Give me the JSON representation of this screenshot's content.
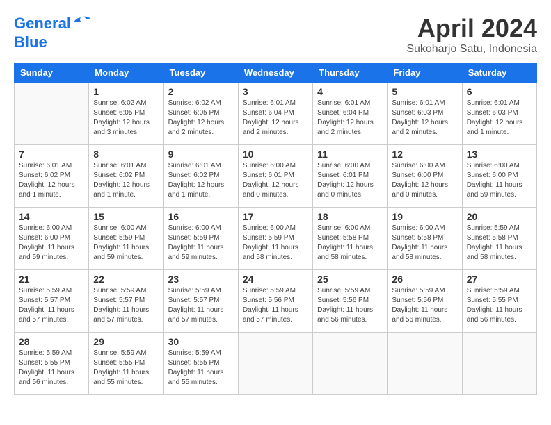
{
  "logo": {
    "line1": "General",
    "line2": "Blue"
  },
  "header": {
    "month_year": "April 2024",
    "location": "Sukoharjo Satu, Indonesia"
  },
  "days_of_week": [
    "Sunday",
    "Monday",
    "Tuesday",
    "Wednesday",
    "Thursday",
    "Friday",
    "Saturday"
  ],
  "weeks": [
    [
      {
        "day": "",
        "info": ""
      },
      {
        "day": "1",
        "info": "Sunrise: 6:02 AM\nSunset: 6:05 PM\nDaylight: 12 hours\nand 3 minutes."
      },
      {
        "day": "2",
        "info": "Sunrise: 6:02 AM\nSunset: 6:05 PM\nDaylight: 12 hours\nand 2 minutes."
      },
      {
        "day": "3",
        "info": "Sunrise: 6:01 AM\nSunset: 6:04 PM\nDaylight: 12 hours\nand 2 minutes."
      },
      {
        "day": "4",
        "info": "Sunrise: 6:01 AM\nSunset: 6:04 PM\nDaylight: 12 hours\nand 2 minutes."
      },
      {
        "day": "5",
        "info": "Sunrise: 6:01 AM\nSunset: 6:03 PM\nDaylight: 12 hours\nand 2 minutes."
      },
      {
        "day": "6",
        "info": "Sunrise: 6:01 AM\nSunset: 6:03 PM\nDaylight: 12 hours\nand 1 minute."
      }
    ],
    [
      {
        "day": "7",
        "info": "Sunrise: 6:01 AM\nSunset: 6:02 PM\nDaylight: 12 hours\nand 1 minute."
      },
      {
        "day": "8",
        "info": "Sunrise: 6:01 AM\nSunset: 6:02 PM\nDaylight: 12 hours\nand 1 minute."
      },
      {
        "day": "9",
        "info": "Sunrise: 6:01 AM\nSunset: 6:02 PM\nDaylight: 12 hours\nand 1 minute."
      },
      {
        "day": "10",
        "info": "Sunrise: 6:00 AM\nSunset: 6:01 PM\nDaylight: 12 hours\nand 0 minutes."
      },
      {
        "day": "11",
        "info": "Sunrise: 6:00 AM\nSunset: 6:01 PM\nDaylight: 12 hours\nand 0 minutes."
      },
      {
        "day": "12",
        "info": "Sunrise: 6:00 AM\nSunset: 6:00 PM\nDaylight: 12 hours\nand 0 minutes."
      },
      {
        "day": "13",
        "info": "Sunrise: 6:00 AM\nSunset: 6:00 PM\nDaylight: 11 hours\nand 59 minutes."
      }
    ],
    [
      {
        "day": "14",
        "info": "Sunrise: 6:00 AM\nSunset: 6:00 PM\nDaylight: 11 hours\nand 59 minutes."
      },
      {
        "day": "15",
        "info": "Sunrise: 6:00 AM\nSunset: 5:59 PM\nDaylight: 11 hours\nand 59 minutes."
      },
      {
        "day": "16",
        "info": "Sunrise: 6:00 AM\nSunset: 5:59 PM\nDaylight: 11 hours\nand 59 minutes."
      },
      {
        "day": "17",
        "info": "Sunrise: 6:00 AM\nSunset: 5:59 PM\nDaylight: 11 hours\nand 58 minutes."
      },
      {
        "day": "18",
        "info": "Sunrise: 6:00 AM\nSunset: 5:58 PM\nDaylight: 11 hours\nand 58 minutes."
      },
      {
        "day": "19",
        "info": "Sunrise: 6:00 AM\nSunset: 5:58 PM\nDaylight: 11 hours\nand 58 minutes."
      },
      {
        "day": "20",
        "info": "Sunrise: 5:59 AM\nSunset: 5:58 PM\nDaylight: 11 hours\nand 58 minutes."
      }
    ],
    [
      {
        "day": "21",
        "info": "Sunrise: 5:59 AM\nSunset: 5:57 PM\nDaylight: 11 hours\nand 57 minutes."
      },
      {
        "day": "22",
        "info": "Sunrise: 5:59 AM\nSunset: 5:57 PM\nDaylight: 11 hours\nand 57 minutes."
      },
      {
        "day": "23",
        "info": "Sunrise: 5:59 AM\nSunset: 5:57 PM\nDaylight: 11 hours\nand 57 minutes."
      },
      {
        "day": "24",
        "info": "Sunrise: 5:59 AM\nSunset: 5:56 PM\nDaylight: 11 hours\nand 57 minutes."
      },
      {
        "day": "25",
        "info": "Sunrise: 5:59 AM\nSunset: 5:56 PM\nDaylight: 11 hours\nand 56 minutes."
      },
      {
        "day": "26",
        "info": "Sunrise: 5:59 AM\nSunset: 5:56 PM\nDaylight: 11 hours\nand 56 minutes."
      },
      {
        "day": "27",
        "info": "Sunrise: 5:59 AM\nSunset: 5:55 PM\nDaylight: 11 hours\nand 56 minutes."
      }
    ],
    [
      {
        "day": "28",
        "info": "Sunrise: 5:59 AM\nSunset: 5:55 PM\nDaylight: 11 hours\nand 56 minutes."
      },
      {
        "day": "29",
        "info": "Sunrise: 5:59 AM\nSunset: 5:55 PM\nDaylight: 11 hours\nand 55 minutes."
      },
      {
        "day": "30",
        "info": "Sunrise: 5:59 AM\nSunset: 5:55 PM\nDaylight: 11 hours\nand 55 minutes."
      },
      {
        "day": "",
        "info": ""
      },
      {
        "day": "",
        "info": ""
      },
      {
        "day": "",
        "info": ""
      },
      {
        "day": "",
        "info": ""
      }
    ]
  ]
}
